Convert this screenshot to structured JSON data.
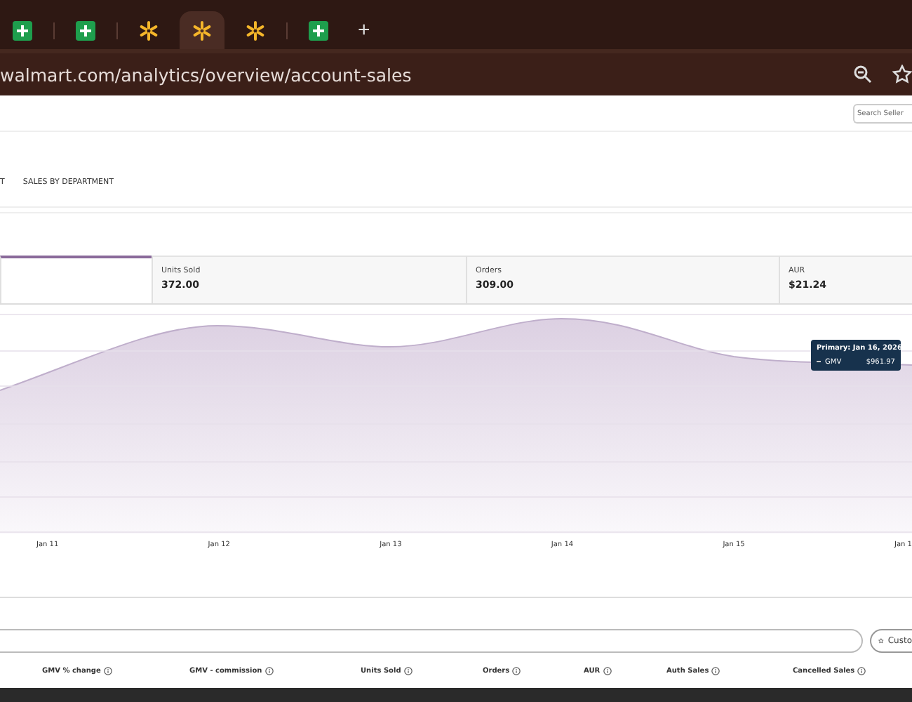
{
  "browser": {
    "tabs": [
      {
        "kind": "sheet",
        "selected": false
      },
      {
        "kind": "sheet",
        "selected": false
      },
      {
        "kind": "spark",
        "selected": false
      },
      {
        "kind": "spark",
        "selected": true
      },
      {
        "kind": "spark",
        "selected": false
      },
      {
        "kind": "sheet",
        "selected": false
      }
    ],
    "new_tab": "+",
    "address": "walmart.com/analytics/overview/account-sales"
  },
  "header": {
    "search": {
      "placeholder": "Search Seller"
    }
  },
  "page_tabs": [
    {
      "label": "T"
    },
    {
      "label": "SALES BY DEPARTMENT"
    }
  ],
  "metric_cards": [
    {
      "selected": true
    },
    {
      "label": "Units Sold",
      "value": "372.00",
      "selected": false
    },
    {
      "label": "Orders",
      "value": "309.00",
      "selected": false
    },
    {
      "label": "AUR",
      "value": "$21.24",
      "selected": false
    }
  ],
  "chart": {
    "x_labels": [
      "Jan 11",
      "Jan 12",
      "Jan 13",
      "Jan 14",
      "Jan 15",
      "Jan 1"
    ],
    "tooltip": {
      "title": "Primary: Jan 16, 2026",
      "series": "GMV",
      "value": "$961.97"
    }
  },
  "table": {
    "customize_button": "Custo",
    "columns": [
      "GMV % change",
      "GMV - commission",
      "Units Sold",
      "Orders",
      "AUR",
      "Auth Sales",
      "Cancelled Sales"
    ]
  }
}
